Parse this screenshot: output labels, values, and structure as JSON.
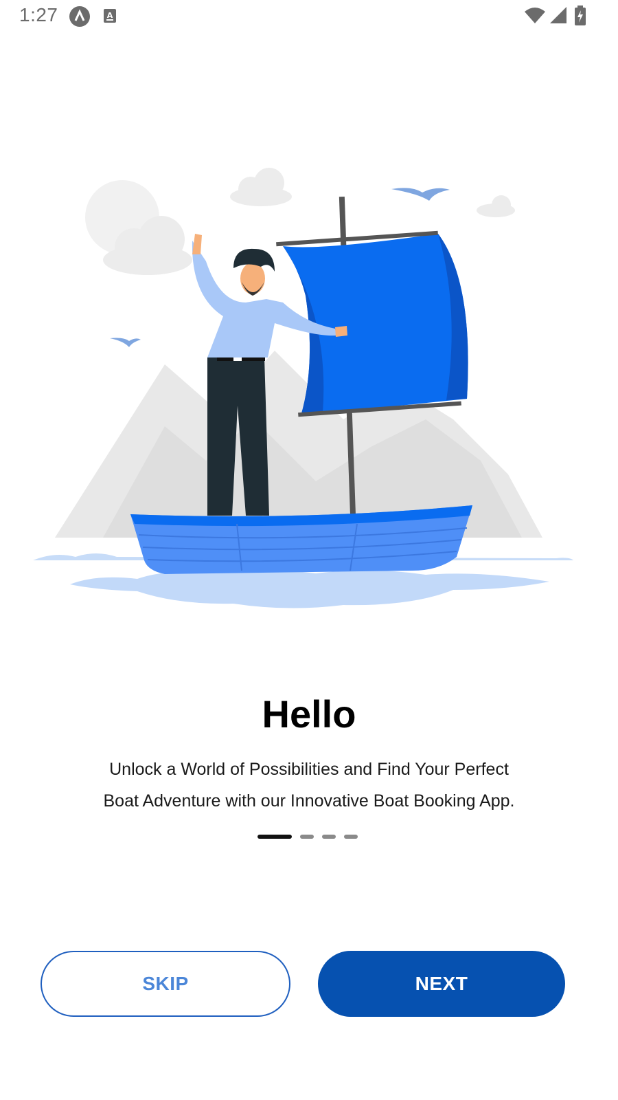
{
  "status_bar": {
    "time": "1:27",
    "icons": [
      "app-notification-icon",
      "keyboard-icon",
      "wifi-icon",
      "cell-signal-icon",
      "battery-charging-icon"
    ]
  },
  "onboarding": {
    "illustration": "man-on-sailboat-illustration",
    "title": "Hello",
    "description_line1": "Unlock a World of Possibilities and Find Your Perfect",
    "description_line2": "Boat Adventure with our Innovative Boat Booking App.",
    "page_count": 4,
    "current_page": 1
  },
  "buttons": {
    "skip_label": "SKIP",
    "next_label": "NEXT"
  },
  "colors": {
    "primary": "#0651b0",
    "skip_text": "#4b86d8",
    "sail": "#1a73e8"
  }
}
